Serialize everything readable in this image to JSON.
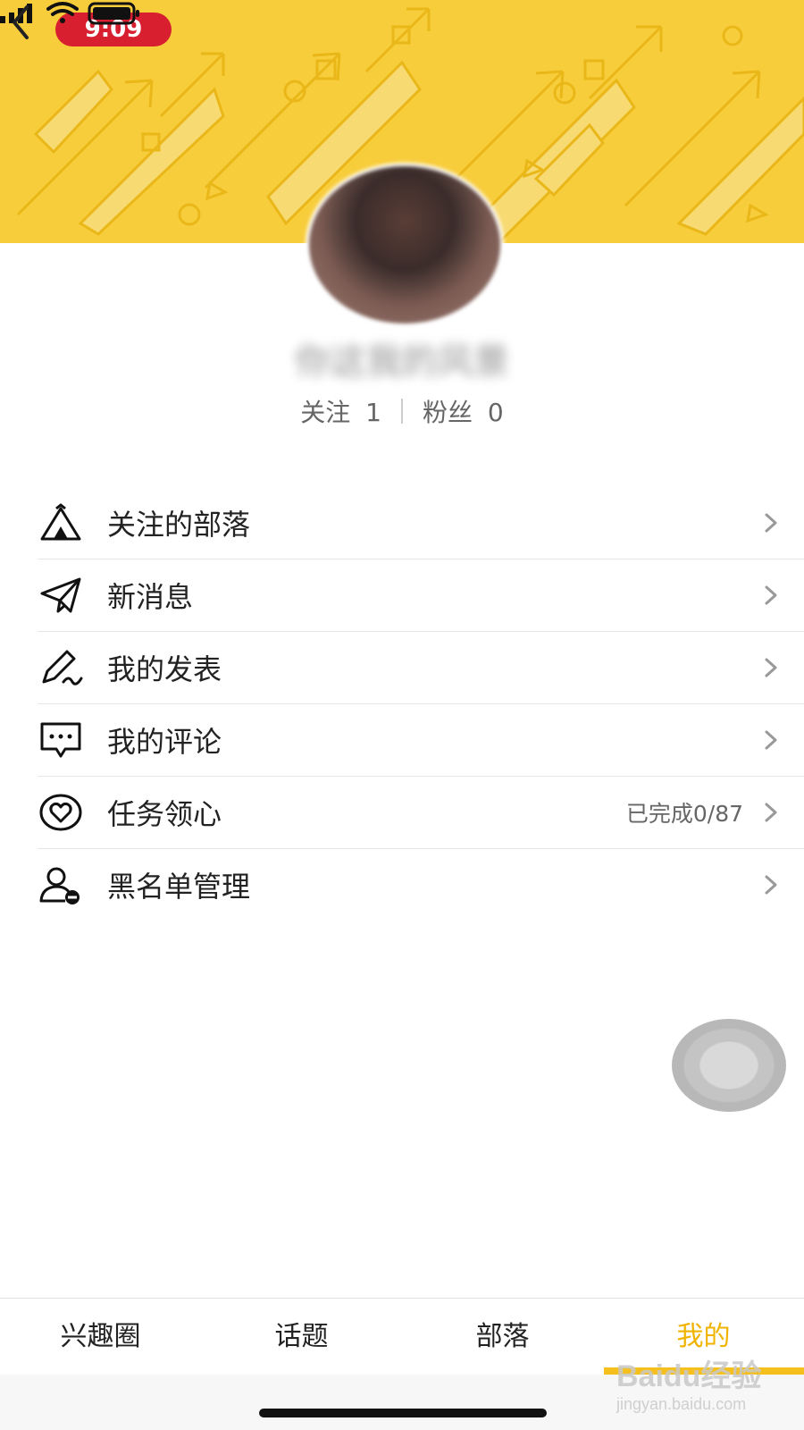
{
  "status_bar": {
    "time": "9:09"
  },
  "profile": {
    "username": "你这我的风景",
    "stats": [
      {
        "label": "关注",
        "value": "1"
      },
      {
        "label": "粉丝",
        "value": "0"
      }
    ]
  },
  "menu": {
    "items": [
      {
        "label": "关注的部落",
        "icon": "tent-icon",
        "extra": ""
      },
      {
        "label": "新消息",
        "icon": "paper-plane-icon",
        "extra": ""
      },
      {
        "label": "我的发表",
        "icon": "pen-icon",
        "extra": ""
      },
      {
        "label": "我的评论",
        "icon": "comment-icon",
        "extra": ""
      },
      {
        "label": "任务领心",
        "icon": "heart-circle-icon",
        "extra": "已完成0/87"
      },
      {
        "label": "黑名单管理",
        "icon": "user-block-icon",
        "extra": ""
      }
    ]
  },
  "tabbar": {
    "tabs": [
      {
        "label": "兴趣圈",
        "active": false
      },
      {
        "label": "话题",
        "active": false
      },
      {
        "label": "部落",
        "active": false
      },
      {
        "label": "我的",
        "active": true
      }
    ]
  },
  "watermark": {
    "brand": "Baidu经验",
    "url": "jingyan.baidu.com"
  },
  "colors": {
    "banner": "#f8cd3c",
    "accent": "#f0b400",
    "status_pill": "#d71f2f"
  }
}
